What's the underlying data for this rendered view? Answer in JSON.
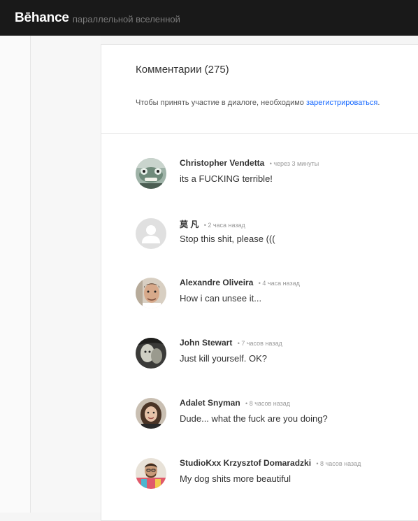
{
  "header": {
    "brand": "Bēhance",
    "subtitle": "параллельной вселенной"
  },
  "comments_section": {
    "title": "Комментарии (275)",
    "signup_prefix": "Чтобы принять участие в диалоге, необходимо ",
    "signup_link": "зарегистрироваться",
    "signup_suffix": "."
  },
  "comments": [
    {
      "author": "Christopher Vendetta",
      "time": "• через 3 минуты",
      "text": "its a FUCKING terrible!",
      "avatar": "frog-mask-avatar"
    },
    {
      "author": "莫 凡",
      "time": "• 2 часа назад",
      "text": "Stop this shit, please (((",
      "avatar": "default-user-avatar"
    },
    {
      "author": "Alexandre Oliveira",
      "time": "• 4 часа назад",
      "text": "How i can unsee it...",
      "avatar": "man-portrait-avatar"
    },
    {
      "author": "John Stewart",
      "time": "• 7 часов назад",
      "text": "Just kill yourself. OK?",
      "avatar": "dark-photo-avatar"
    },
    {
      "author": "Adalet Snyman",
      "time": "• 8 часов назад",
      "text": "Dude... what the fuck are you doing?",
      "avatar": "woman-portrait-avatar"
    },
    {
      "author": "StudioKxx Krzysztof Domaradzki",
      "time": "• 8 часов назад",
      "text": "My dog shits more beautiful",
      "avatar": "colorful-man-avatar"
    }
  ],
  "colors": {
    "topbar": "#191919",
    "link": "#1769ff",
    "text": "#333333",
    "muted": "#999999"
  }
}
